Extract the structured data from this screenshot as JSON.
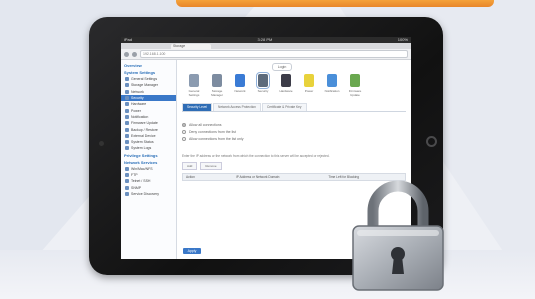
{
  "window": {
    "status": {
      "left": "iPad",
      "center": "3:28 PM",
      "right": "100%"
    },
    "tab_label": "Storage",
    "address": "192.168.1.100"
  },
  "sidebar": {
    "items": [
      {
        "label": "Overview",
        "kind": "head"
      },
      {
        "label": "System Settings",
        "kind": "head"
      },
      {
        "label": "General Settings",
        "kind": "item"
      },
      {
        "label": "Storage Manager",
        "kind": "item"
      },
      {
        "label": "Network",
        "kind": "item"
      },
      {
        "label": "Security",
        "kind": "active"
      },
      {
        "label": "Hardware",
        "kind": "item"
      },
      {
        "label": "Power",
        "kind": "item"
      },
      {
        "label": "Notification",
        "kind": "item"
      },
      {
        "label": "Firmware Update",
        "kind": "item"
      },
      {
        "label": "Backup / Restore",
        "kind": "item"
      },
      {
        "label": "External Device",
        "kind": "item"
      },
      {
        "label": "System Status",
        "kind": "item"
      },
      {
        "label": "System Logs",
        "kind": "item"
      },
      {
        "label": "Privilege Settings",
        "kind": "head"
      },
      {
        "label": "Network Services",
        "kind": "head"
      },
      {
        "label": "Win/Mac/NFS",
        "kind": "item"
      },
      {
        "label": "FTP",
        "kind": "item"
      },
      {
        "label": "Telnet / SSH",
        "kind": "item"
      },
      {
        "label": "SNMP",
        "kind": "item"
      },
      {
        "label": "Service Discovery",
        "kind": "item"
      }
    ]
  },
  "main": {
    "pill": "Login",
    "icons": [
      {
        "label": "General Settings",
        "color": "#8b9bb0"
      },
      {
        "label": "Storage Manager",
        "color": "#7d8ca0"
      },
      {
        "label": "Network",
        "color": "#3a7bd5"
      },
      {
        "label": "Security",
        "color": "#5d6b7c"
      },
      {
        "label": "Hardware",
        "color": "#3c3c48"
      },
      {
        "label": "Power",
        "color": "#e8d23b"
      },
      {
        "label": "Notification",
        "color": "#4a8fd9"
      },
      {
        "label": "Firmware Update",
        "color": "#6aa84f"
      }
    ],
    "subtabs": [
      "Security Level",
      "Network Access Protection",
      "Certificate & Private Key"
    ],
    "radios": [
      {
        "label": "Allow all connections",
        "on": true
      },
      {
        "label": "Deny connections from the list",
        "on": false
      },
      {
        "label": "Allow connections from the list only",
        "on": false
      }
    ],
    "note": "Enter the IP address or the network from which the connection to this server will be accepted or rejected.",
    "tools": [
      "Add",
      "Remove"
    ],
    "columns": [
      "Action",
      "IP Address or Network Domain",
      "Time Left for Blocking"
    ],
    "apply_label": "Apply"
  }
}
